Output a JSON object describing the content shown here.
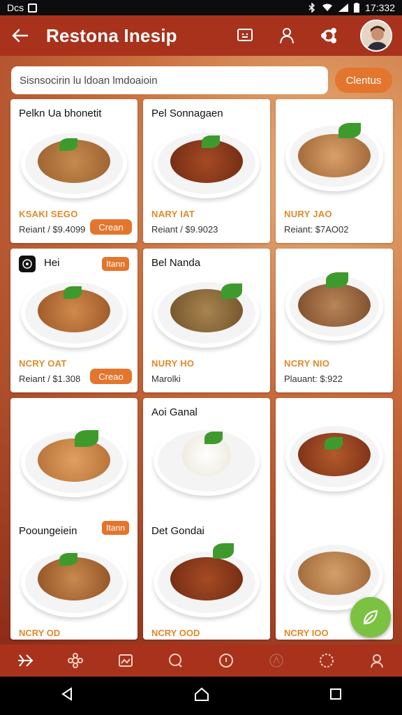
{
  "status_bar": {
    "left_text": "Dcs",
    "time": "17:332"
  },
  "app_bar": {
    "title": "Restona Inesip",
    "icons": [
      "back-arrow-icon",
      "chat-icon",
      "user-icon",
      "share-icon"
    ]
  },
  "search": {
    "placeholder": "Sisnsocirin lu ldoan lmdoaioin",
    "filter_label": "Clentus"
  },
  "cards": [
    {
      "name": "Pelkn Ua bhonetit",
      "price": "KSAKI SEGO",
      "sub": "Reiant / $9.4099",
      "tag": "Crean",
      "food": "#b9783d"
    },
    {
      "name": "Pel Sonnagaen",
      "price": "NARY IAT",
      "sub": "Reiant / $9.9023",
      "food": "#8a3a1c"
    },
    {
      "name": "",
      "price": "NURY JAO",
      "sub": "Reiant: $7AO02",
      "food": "#c58850"
    },
    {
      "name": "Hei",
      "price": "NCRY OAT",
      "sub": "Reiant / $1.308",
      "tag": "Creao",
      "tag_small": "Itann",
      "food": "#c47a3b"
    },
    {
      "name": "Bel Nanda",
      "price": "NURY HO",
      "sub": "Marolki",
      "food": "#8c6a37"
    },
    {
      "name": "",
      "price": "NCRY NIO",
      "sub": "Plauant: $:922",
      "food": "#a6703d"
    },
    {
      "name": "Pooungeiein",
      "tag_small": "Itann",
      "price": "NCRY OD",
      "food": "#d99a5a"
    },
    {
      "name": "Aoi Ganal",
      "food": "#f2eee6"
    },
    {
      "name": "",
      "food": "#a24a24"
    },
    {
      "name": "Det Gondai",
      "price": "NCRY OOD",
      "food": "#8a3a1c"
    },
    {
      "name": "",
      "price": "NCRY IOO",
      "food": "#c58850"
    }
  ],
  "tab_bar": [
    "plane-icon",
    "flower-icon",
    "image-icon",
    "chat-bubble-icon",
    "info-icon",
    "chef-icon",
    "globe-icon",
    "person-icon"
  ],
  "colors": {
    "app_bar": "#a8321c",
    "accent": "#e3752d",
    "price": "#e08a2a",
    "fab": "#7cc242"
  }
}
